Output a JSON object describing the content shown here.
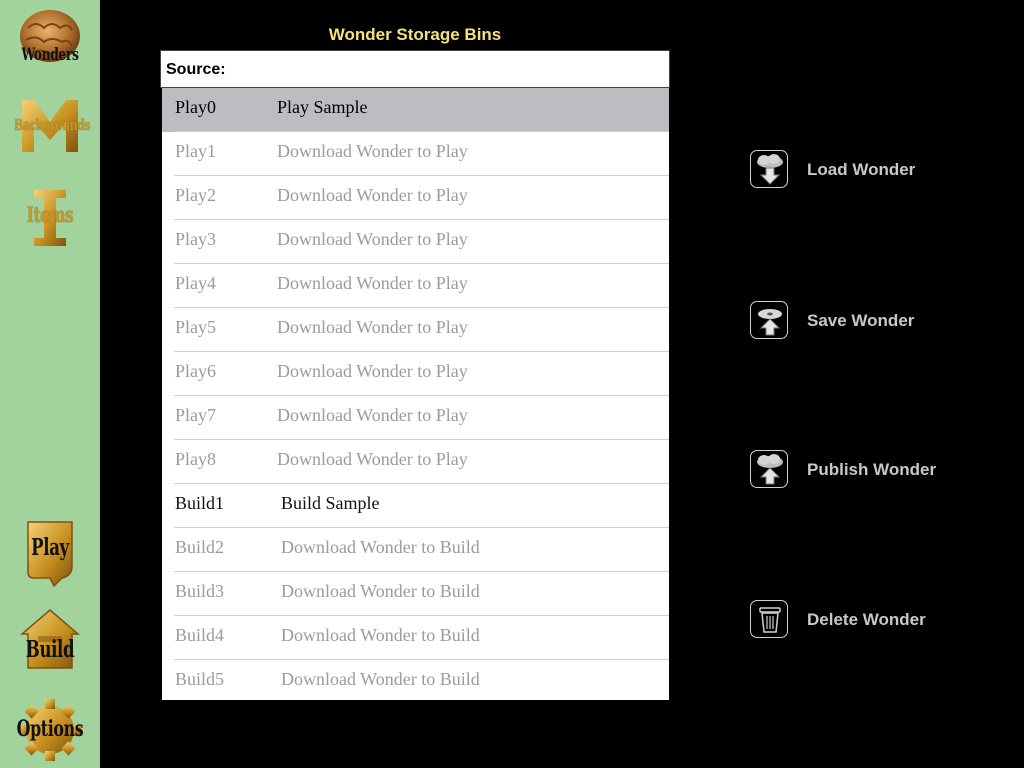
{
  "sidebar": {
    "wonders": "Wonders",
    "backgrounds": "Backgrounds",
    "items": "Items",
    "play": "Play",
    "build": "Build",
    "options": "Options"
  },
  "header": {
    "title": "Wonder Storage Bins",
    "source_label": "Source:"
  },
  "bins": [
    {
      "slot": "Play0",
      "desc": "Play Sample",
      "kind": "play",
      "state": "selected"
    },
    {
      "slot": "Play1",
      "desc": "Download Wonder to Play",
      "kind": "play",
      "state": "empty"
    },
    {
      "slot": "Play2",
      "desc": "Download Wonder to Play",
      "kind": "play",
      "state": "empty"
    },
    {
      "slot": "Play3",
      "desc": "Download Wonder to Play",
      "kind": "play",
      "state": "empty"
    },
    {
      "slot": "Play4",
      "desc": "Download Wonder to Play",
      "kind": "play",
      "state": "empty"
    },
    {
      "slot": "Play5",
      "desc": "Download Wonder to Play",
      "kind": "play",
      "state": "empty"
    },
    {
      "slot": "Play6",
      "desc": "Download Wonder to Play",
      "kind": "play",
      "state": "empty"
    },
    {
      "slot": "Play7",
      "desc": "Download Wonder to Play",
      "kind": "play",
      "state": "empty"
    },
    {
      "slot": "Play8",
      "desc": "Download Wonder to Play",
      "kind": "play",
      "state": "empty"
    },
    {
      "slot": "Build1",
      "desc": "Build Sample",
      "kind": "build",
      "state": "filled"
    },
    {
      "slot": "Build2",
      "desc": "Download Wonder to Build",
      "kind": "build",
      "state": "empty"
    },
    {
      "slot": "Build3",
      "desc": "Download Wonder to Build",
      "kind": "build",
      "state": "empty"
    },
    {
      "slot": "Build4",
      "desc": "Download Wonder to Build",
      "kind": "build",
      "state": "empty"
    },
    {
      "slot": "Build5",
      "desc": "Download Wonder to Build",
      "kind": "build",
      "state": "empty"
    }
  ],
  "actions": {
    "load": "Load Wonder",
    "save": "Save Wonder",
    "publish": "Publish Wonder",
    "delete": "Delete Wonder"
  },
  "icons": {
    "wonders": "brain-icon",
    "backgrounds": "backgrounds-icon",
    "items": "items-icon",
    "play": "play-icon",
    "build": "build-house-icon",
    "options": "gear-icon",
    "load": "cloud-download-icon",
    "save": "disk-upload-icon",
    "publish": "cloud-upload-icon",
    "delete": "trash-icon"
  },
  "colors": {
    "sidebar_bg": "#a2d39c",
    "title": "#f4e27a",
    "selected_row": "#bdbcc1",
    "empty_text": "#9b9b9b",
    "gold": "#c59a2a"
  }
}
